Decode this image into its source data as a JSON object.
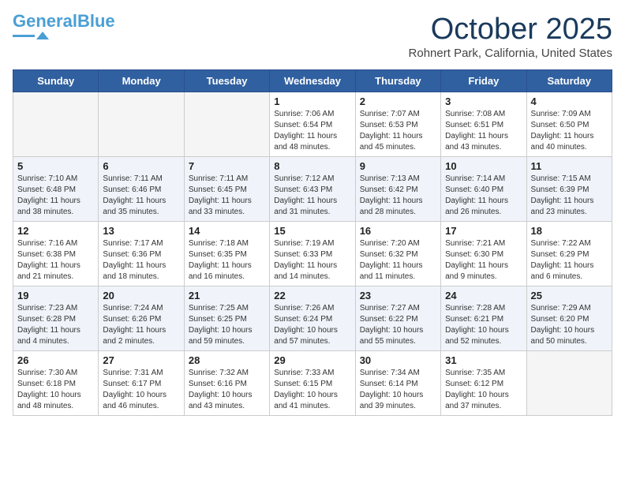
{
  "header": {
    "logo_general": "General",
    "logo_blue": "Blue",
    "month": "October 2025",
    "location": "Rohnert Park, California, United States"
  },
  "weekdays": [
    "Sunday",
    "Monday",
    "Tuesday",
    "Wednesday",
    "Thursday",
    "Friday",
    "Saturday"
  ],
  "weeks": [
    [
      {
        "day": "",
        "info": ""
      },
      {
        "day": "",
        "info": ""
      },
      {
        "day": "",
        "info": ""
      },
      {
        "day": "1",
        "info": "Sunrise: 7:06 AM\nSunset: 6:54 PM\nDaylight: 11 hours and 48 minutes."
      },
      {
        "day": "2",
        "info": "Sunrise: 7:07 AM\nSunset: 6:53 PM\nDaylight: 11 hours and 45 minutes."
      },
      {
        "day": "3",
        "info": "Sunrise: 7:08 AM\nSunset: 6:51 PM\nDaylight: 11 hours and 43 minutes."
      },
      {
        "day": "4",
        "info": "Sunrise: 7:09 AM\nSunset: 6:50 PM\nDaylight: 11 hours and 40 minutes."
      }
    ],
    [
      {
        "day": "5",
        "info": "Sunrise: 7:10 AM\nSunset: 6:48 PM\nDaylight: 11 hours and 38 minutes."
      },
      {
        "day": "6",
        "info": "Sunrise: 7:11 AM\nSunset: 6:46 PM\nDaylight: 11 hours and 35 minutes."
      },
      {
        "day": "7",
        "info": "Sunrise: 7:11 AM\nSunset: 6:45 PM\nDaylight: 11 hours and 33 minutes."
      },
      {
        "day": "8",
        "info": "Sunrise: 7:12 AM\nSunset: 6:43 PM\nDaylight: 11 hours and 31 minutes."
      },
      {
        "day": "9",
        "info": "Sunrise: 7:13 AM\nSunset: 6:42 PM\nDaylight: 11 hours and 28 minutes."
      },
      {
        "day": "10",
        "info": "Sunrise: 7:14 AM\nSunset: 6:40 PM\nDaylight: 11 hours and 26 minutes."
      },
      {
        "day": "11",
        "info": "Sunrise: 7:15 AM\nSunset: 6:39 PM\nDaylight: 11 hours and 23 minutes."
      }
    ],
    [
      {
        "day": "12",
        "info": "Sunrise: 7:16 AM\nSunset: 6:38 PM\nDaylight: 11 hours and 21 minutes."
      },
      {
        "day": "13",
        "info": "Sunrise: 7:17 AM\nSunset: 6:36 PM\nDaylight: 11 hours and 18 minutes."
      },
      {
        "day": "14",
        "info": "Sunrise: 7:18 AM\nSunset: 6:35 PM\nDaylight: 11 hours and 16 minutes."
      },
      {
        "day": "15",
        "info": "Sunrise: 7:19 AM\nSunset: 6:33 PM\nDaylight: 11 hours and 14 minutes."
      },
      {
        "day": "16",
        "info": "Sunrise: 7:20 AM\nSunset: 6:32 PM\nDaylight: 11 hours and 11 minutes."
      },
      {
        "day": "17",
        "info": "Sunrise: 7:21 AM\nSunset: 6:30 PM\nDaylight: 11 hours and 9 minutes."
      },
      {
        "day": "18",
        "info": "Sunrise: 7:22 AM\nSunset: 6:29 PM\nDaylight: 11 hours and 6 minutes."
      }
    ],
    [
      {
        "day": "19",
        "info": "Sunrise: 7:23 AM\nSunset: 6:28 PM\nDaylight: 11 hours and 4 minutes."
      },
      {
        "day": "20",
        "info": "Sunrise: 7:24 AM\nSunset: 6:26 PM\nDaylight: 11 hours and 2 minutes."
      },
      {
        "day": "21",
        "info": "Sunrise: 7:25 AM\nSunset: 6:25 PM\nDaylight: 10 hours and 59 minutes."
      },
      {
        "day": "22",
        "info": "Sunrise: 7:26 AM\nSunset: 6:24 PM\nDaylight: 10 hours and 57 minutes."
      },
      {
        "day": "23",
        "info": "Sunrise: 7:27 AM\nSunset: 6:22 PM\nDaylight: 10 hours and 55 minutes."
      },
      {
        "day": "24",
        "info": "Sunrise: 7:28 AM\nSunset: 6:21 PM\nDaylight: 10 hours and 52 minutes."
      },
      {
        "day": "25",
        "info": "Sunrise: 7:29 AM\nSunset: 6:20 PM\nDaylight: 10 hours and 50 minutes."
      }
    ],
    [
      {
        "day": "26",
        "info": "Sunrise: 7:30 AM\nSunset: 6:18 PM\nDaylight: 10 hours and 48 minutes."
      },
      {
        "day": "27",
        "info": "Sunrise: 7:31 AM\nSunset: 6:17 PM\nDaylight: 10 hours and 46 minutes."
      },
      {
        "day": "28",
        "info": "Sunrise: 7:32 AM\nSunset: 6:16 PM\nDaylight: 10 hours and 43 minutes."
      },
      {
        "day": "29",
        "info": "Sunrise: 7:33 AM\nSunset: 6:15 PM\nDaylight: 10 hours and 41 minutes."
      },
      {
        "day": "30",
        "info": "Sunrise: 7:34 AM\nSunset: 6:14 PM\nDaylight: 10 hours and 39 minutes."
      },
      {
        "day": "31",
        "info": "Sunrise: 7:35 AM\nSunset: 6:12 PM\nDaylight: 10 hours and 37 minutes."
      },
      {
        "day": "",
        "info": ""
      }
    ]
  ]
}
